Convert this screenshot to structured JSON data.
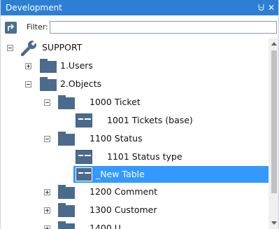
{
  "window": {
    "title": "Development",
    "pin_glyph": "⨄",
    "close_glyph": "✕"
  },
  "toolbar": {
    "button_icon": "goto-arrow-icon",
    "filter_label": "Filter:",
    "filter_value": "",
    "filter_placeholder": ""
  },
  "tree": {
    "items": [
      {
        "label": "SUPPORT",
        "icon": "wrench-icon",
        "expanded": true
      },
      {
        "label": "1.Users",
        "icon": "folder-icon",
        "expanded": false
      },
      {
        "label": "2.Objects",
        "icon": "folder-icon",
        "expanded": true
      },
      {
        "label": "1000 Ticket",
        "icon": "folder-icon",
        "expanded": true
      },
      {
        "label": "1001 Tickets (base)",
        "icon": "table-icon"
      },
      {
        "label": "1100 Status",
        "icon": "folder-icon",
        "expanded": true
      },
      {
        "label": "1101 Status type",
        "icon": "table-icon"
      },
      {
        "label": "_New Table",
        "icon": "table-icon",
        "selected": true
      },
      {
        "label": "1200 Comment",
        "icon": "folder-icon",
        "expanded": false
      },
      {
        "label": "1300 Customer",
        "icon": "folder-icon",
        "expanded": false
      },
      {
        "label": "1400 U...",
        "icon": "folder-icon",
        "expanded": false
      }
    ]
  },
  "colors": {
    "titlebar": "#2d7fd3",
    "selection": "#3399ff",
    "icon": "#4b6b8c"
  }
}
